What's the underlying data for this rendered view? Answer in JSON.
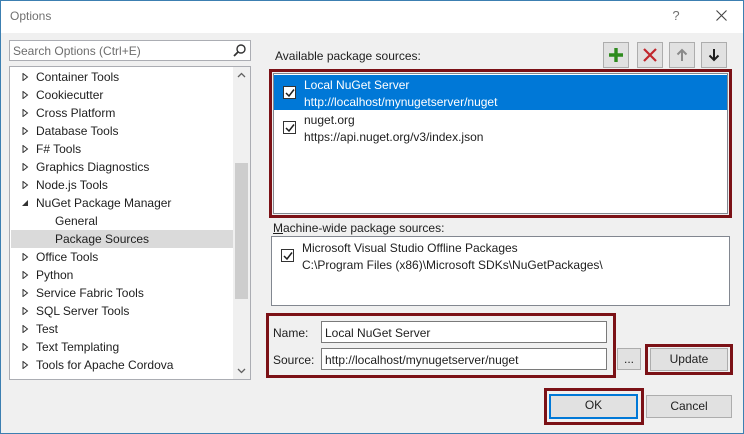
{
  "window": {
    "title": "Options",
    "help_glyph": "?",
    "accent": "#0078d7",
    "highlight_color": "#7b1116"
  },
  "search": {
    "placeholder": "Search Options (Ctrl+E)",
    "value": ""
  },
  "tree": {
    "items": [
      {
        "label": "Container Tools",
        "level": 0,
        "expander": "collapsed",
        "selected": false
      },
      {
        "label": "Cookiecutter",
        "level": 0,
        "expander": "collapsed",
        "selected": false
      },
      {
        "label": "Cross Platform",
        "level": 0,
        "expander": "collapsed",
        "selected": false
      },
      {
        "label": "Database Tools",
        "level": 0,
        "expander": "collapsed",
        "selected": false
      },
      {
        "label": "F# Tools",
        "level": 0,
        "expander": "collapsed",
        "selected": false
      },
      {
        "label": "Graphics Diagnostics",
        "level": 0,
        "expander": "collapsed",
        "selected": false
      },
      {
        "label": "Node.js Tools",
        "level": 0,
        "expander": "collapsed",
        "selected": false
      },
      {
        "label": "NuGet Package Manager",
        "level": 0,
        "expander": "expanded",
        "selected": false
      },
      {
        "label": "General",
        "level": 1,
        "expander": "none",
        "selected": false
      },
      {
        "label": "Package Sources",
        "level": 1,
        "expander": "none",
        "selected": true
      },
      {
        "label": "Office Tools",
        "level": 0,
        "expander": "collapsed",
        "selected": false
      },
      {
        "label": "Python",
        "level": 0,
        "expander": "collapsed",
        "selected": false
      },
      {
        "label": "Service Fabric Tools",
        "level": 0,
        "expander": "collapsed",
        "selected": false
      },
      {
        "label": "SQL Server Tools",
        "level": 0,
        "expander": "collapsed",
        "selected": false
      },
      {
        "label": "Test",
        "level": 0,
        "expander": "collapsed",
        "selected": false
      },
      {
        "label": "Text Templating",
        "level": 0,
        "expander": "collapsed",
        "selected": false
      },
      {
        "label": "Tools for Apache Cordova",
        "level": 0,
        "expander": "collapsed",
        "selected": false
      }
    ]
  },
  "available_sources": {
    "label": "Available package sources:",
    "items": [
      {
        "name": "Local NuGet Server",
        "url": "http://localhost/mynugetserver/nuget",
        "checked": true,
        "selected": true
      },
      {
        "name": "nuget.org",
        "url": "https://api.nuget.org/v3/index.json",
        "checked": true,
        "selected": false
      }
    ]
  },
  "toolbar": {
    "add": "add-icon",
    "remove": "remove-icon",
    "move_up": "arrow-up-icon",
    "move_down": "arrow-down-icon",
    "add_color": "#2e8b1e",
    "remove_color": "#c1272d"
  },
  "machine_sources": {
    "label": "Machine-wide package sources:",
    "items": [
      {
        "name": "Microsoft Visual Studio Offline Packages",
        "url": "C:\\Program Files (x86)\\Microsoft SDKs\\NuGetPackages\\",
        "checked": true
      }
    ]
  },
  "form": {
    "name_label": "Name:",
    "name_value": "Local NuGet Server",
    "source_label": "Source:",
    "source_value": "http://localhost/mynugetserver/nuget",
    "browse_label": "...",
    "update_label": "Update"
  },
  "footer": {
    "ok_label": "OK",
    "cancel_label": "Cancel"
  }
}
